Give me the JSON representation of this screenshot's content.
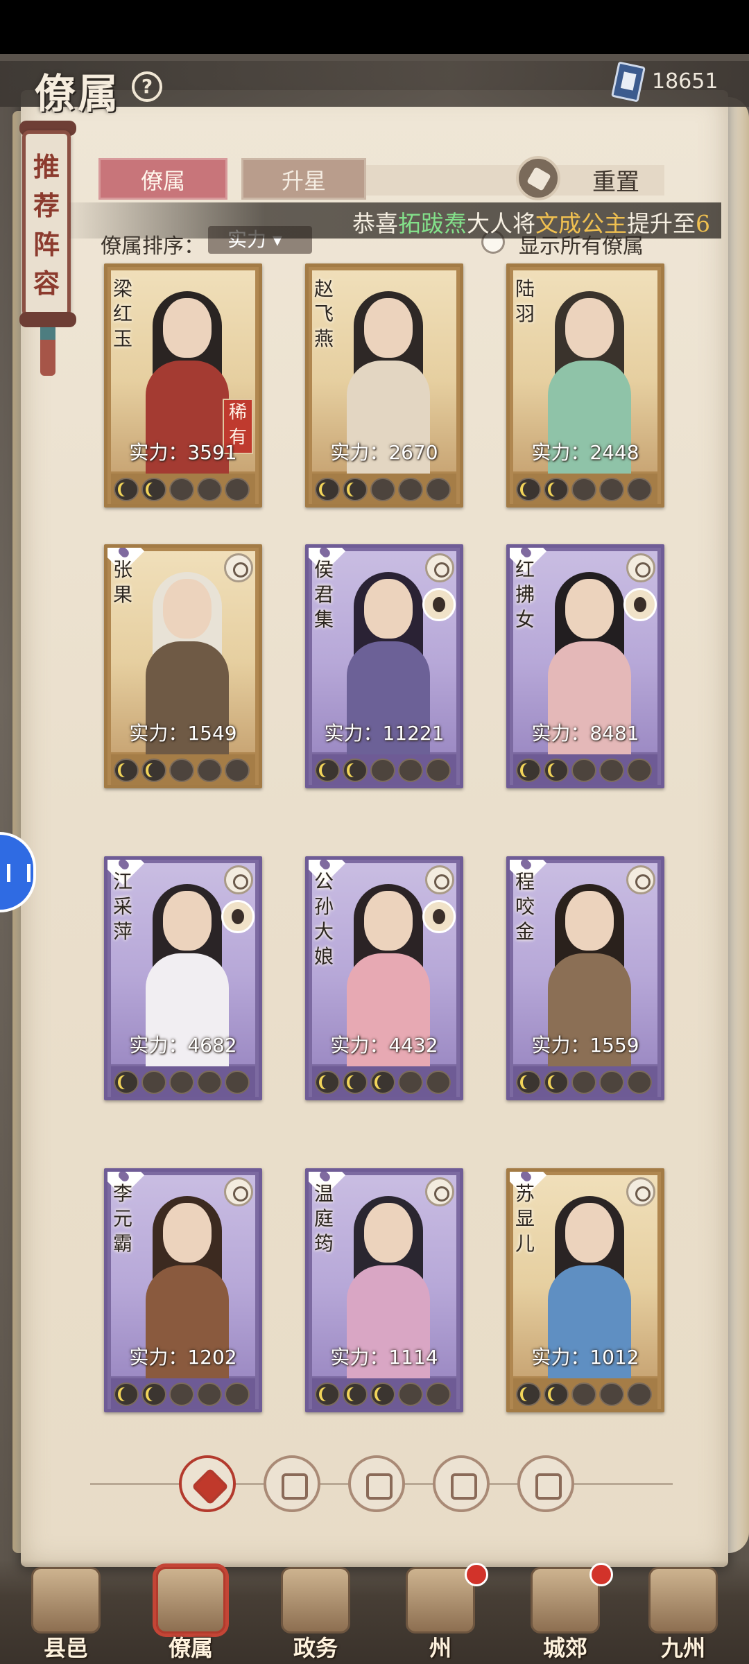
{
  "header": {
    "title": "僚属",
    "help_icon": "question-circle-icon",
    "currency_icon": "scroll-book-icon",
    "currency_value": "18651"
  },
  "side_ribbon": {
    "label_lines": [
      "推",
      "荐",
      "阵",
      "容"
    ]
  },
  "tabs": [
    {
      "label": "僚属",
      "active": true
    },
    {
      "label": "升星",
      "active": false
    }
  ],
  "reset": {
    "label": "重置",
    "icon": "reset-hands-icon"
  },
  "marquee": {
    "prefix": "恭喜",
    "player": "拓跋焘",
    "middle": "大人将",
    "target": "文成公主",
    "suffix": "提升至",
    "tail": "6"
  },
  "sort": {
    "label": "僚属排序：",
    "selected": "实力"
  },
  "show_all": {
    "label": "显示所有僚属",
    "checked": false
  },
  "power_prefix": "实力：",
  "cards": [
    {
      "name": "梁红玉",
      "power": "3591",
      "frame": "gold",
      "stars_on": 2,
      "rarity": "稀有",
      "robe": "#a43b32",
      "hair": "#2a2422"
    },
    {
      "name": "赵飞燕",
      "power": "2670",
      "frame": "gold",
      "stars_on": 2,
      "robe": "#e3d6c2",
      "hair": "#2e2826"
    },
    {
      "name": "陆羽",
      "power": "2448",
      "frame": "gold",
      "stars_on": 2,
      "robe": "#8fc3a8",
      "hair": "#3a332c"
    },
    {
      "name": "张果",
      "power": "1549",
      "frame": "gold",
      "stars_on": 2,
      "class_icon": "yin-yang-icon",
      "robe": "#6f5a45",
      "hair": "#e8e2d6"
    },
    {
      "name": "侯君集",
      "power": "11221",
      "frame": "purple",
      "stars_on": 2,
      "class_icon": "sword-icon",
      "has_portrait_badge": true,
      "robe": "#6c6197",
      "hair": "#2a2234"
    },
    {
      "name": "红拂女",
      "power": "8481",
      "frame": "purple",
      "stars_on": 2,
      "class_icon": "yin-yang-icon",
      "has_portrait_badge": true,
      "robe": "#e4b8b8",
      "hair": "#221e20"
    },
    {
      "name": "江采萍",
      "power": "4682",
      "frame": "purple",
      "stars_on": 1,
      "class_icon": "lotus-icon",
      "has_portrait_badge": true,
      "robe": "#f1eef2",
      "hair": "#2a2426"
    },
    {
      "name": "公孙大娘",
      "power": "4432",
      "frame": "purple",
      "stars_on": 3,
      "class_icon": "sword-icon",
      "has_portrait_badge": true,
      "robe": "#e7a9b3",
      "hair": "#2b2325"
    },
    {
      "name": "程咬金",
      "power": "1559",
      "frame": "purple",
      "stars_on": 2,
      "class_icon": "shield-icon",
      "robe": "#8b6f55",
      "hair": "#2a211c"
    },
    {
      "name": "李元霸",
      "power": "1202",
      "frame": "purple",
      "stars_on": 2,
      "class_icon": "shield-icon",
      "robe": "#8a5a3e",
      "hair": "#3c2a20"
    },
    {
      "name": "温庭筠",
      "power": "1114",
      "frame": "purple",
      "stars_on": 3,
      "class_icon": "yin-yang-icon",
      "robe": "#d9a6c4",
      "hair": "#2a2630"
    },
    {
      "name": "苏显儿",
      "power": "1012",
      "frame": "gold",
      "stars_on": 2,
      "class_icon": "sword-icon",
      "robe": "#5f8fc2",
      "hair": "#2a2424"
    }
  ],
  "filters": [
    {
      "icon": "all-diamond-icon",
      "active": true
    },
    {
      "icon": "bell-hat-icon",
      "active": false
    },
    {
      "icon": "cloud-gourd-icon",
      "active": false
    },
    {
      "icon": "fan-icon",
      "active": false
    },
    {
      "icon": "lion-icon",
      "active": false
    }
  ],
  "bottom_nav": [
    {
      "label": "县邑",
      "active": false,
      "badge": false
    },
    {
      "label": "僚属",
      "active": true,
      "badge": false
    },
    {
      "label": "政务",
      "active": false,
      "badge": false
    },
    {
      "label": "州",
      "active": false,
      "badge": true
    },
    {
      "label": "城郊",
      "active": false,
      "badge": true
    },
    {
      "label": "九州",
      "active": false,
      "badge": false
    }
  ],
  "colors": {
    "gold_frame": "#b08750",
    "purple_frame": "#7c6aa1",
    "active_tab": "#c8757a",
    "accent_red": "#b33a2d"
  }
}
